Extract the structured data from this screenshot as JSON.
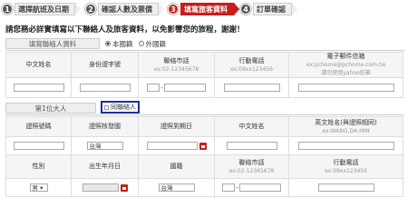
{
  "steps": [
    {
      "num": "1",
      "label": "選擇航班及日期"
    },
    {
      "num": "2",
      "label": "確認人數及票價"
    },
    {
      "num": "3",
      "label": "填寫旅客資料"
    },
    {
      "num": "4",
      "label": "訂單確認"
    }
  ],
  "active_step": 3,
  "notice": "請您務必詳實填寫以下聯絡人及旅客資料，以免影響您的旅程，謝謝！",
  "contact": {
    "tab_label": "填寫聯絡人資料",
    "radio_domestic": "本國籍",
    "radio_foreign": "外國籍",
    "headers": {
      "name": "中文姓名",
      "id": "身份證字號",
      "phone": "聯絡市話",
      "phone_hint": "ex:02-12345678",
      "mobile": "行動電話",
      "mobile_hint": "ex:09xx123456",
      "email": "電子郵件信箱",
      "email_hint": "ex:pchome@pchome.com.tw",
      "email_hint2": "請勿使用yahoo信箱"
    }
  },
  "passenger": {
    "tab_label": "第1位大人",
    "same_as_contact": "同聯絡人",
    "headers_row1": {
      "doc_type": "證照號碼",
      "issuer": "證照核發國",
      "expiry": "證照到期日",
      "name": "中文姓名",
      "en_name": "英文姓名(與證照相同)",
      "en_hint": "ex:WANG,DA-MIN"
    },
    "issuer_value": "台灣",
    "headers_row2": {
      "gender": "性別",
      "dob": "出生年月日",
      "nationality": "國籍",
      "phone": "聯絡市話",
      "phone_hint": "ex:02-12345678",
      "mobile": "行動電話",
      "mobile_hint": "ex:09xx123456"
    },
    "gender_value": "男",
    "nationality_value": "台灣"
  }
}
